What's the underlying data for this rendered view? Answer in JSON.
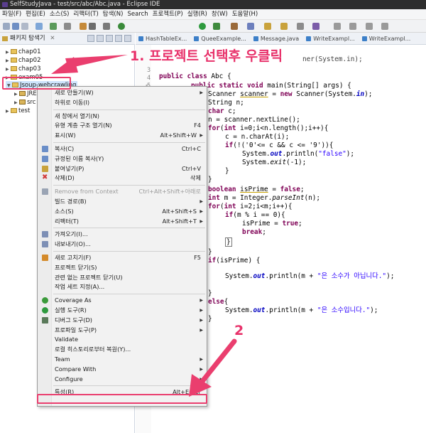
{
  "window": {
    "title": "SelfStudyJava - test/src/abc/Abc.java - Eclipse IDE"
  },
  "menubar": [
    "파일(F)",
    "편집(E)",
    "소스(S)",
    "리팩터(T)",
    "탐색(N)",
    "Search",
    "프로젝트(P)",
    "실행(R)",
    "창(W)",
    "도움말(H)"
  ],
  "explorer": {
    "title": "패키지 탐색기",
    "close": "✕",
    "items": [
      {
        "label": "chap01",
        "level": 0
      },
      {
        "label": "chap02",
        "level": 0
      },
      {
        "label": "chap03",
        "level": 0
      },
      {
        "label": "exam05",
        "level": 0
      },
      {
        "label": "Jsoup-webcrawling",
        "level": 0,
        "selected": true
      },
      {
        "label": "JRE",
        "level": 1
      },
      {
        "label": "src",
        "level": 1
      },
      {
        "label": "test",
        "level": 0
      }
    ]
  },
  "editor": {
    "tabs": [
      "HashTableEx...",
      "QueeExample...",
      "Message.java",
      "WriteExampl...",
      "WriteExampl..."
    ],
    "line_numbers": [
      "3",
      "4",
      "5",
      "5"
    ],
    "partial_line": "ner(System.in);"
  },
  "context_menu": {
    "items": [
      {
        "label": "새로 만들기(W)",
        "shortcut": "",
        "submenu": true
      },
      {
        "label": "하위로 이동(I)",
        "shortcut": ""
      },
      {
        "sep": true
      },
      {
        "label": "새 창에서 열기(N)",
        "shortcut": ""
      },
      {
        "label": "유형 계층 구조 열기(N)",
        "shortcut": "F4"
      },
      {
        "label": "표시(W)",
        "shortcut": "Alt+Shift+W",
        "submenu": true
      },
      {
        "sep": true
      },
      {
        "label": "복사(C)",
        "shortcut": "Ctrl+C",
        "icon": "copy-icon"
      },
      {
        "label": "규정된 이름 복사(Y)",
        "shortcut": "",
        "icon": "copy-icon"
      },
      {
        "label": "붙여넣기(P)",
        "shortcut": "Ctrl+V",
        "icon": "paste-icon"
      },
      {
        "label": "삭제(D)",
        "shortcut": "삭제",
        "icon": "delete-icon"
      },
      {
        "sep": true
      },
      {
        "label": "Remove from Context",
        "shortcut": "Ctrl+Alt+Shift+아래로",
        "dim": true,
        "icon": "remove-icon"
      },
      {
        "label": "빌드 경로(B)",
        "shortcut": "",
        "submenu": true
      },
      {
        "label": "소스(S)",
        "shortcut": "Alt+Shift+S",
        "submenu": true
      },
      {
        "label": "리팩터(T)",
        "shortcut": "Alt+Shift+T",
        "submenu": true
      },
      {
        "sep": true
      },
      {
        "label": "가져오기(I)...",
        "shortcut": "",
        "icon": "import-icon"
      },
      {
        "label": "내보내기(O)...",
        "shortcut": "",
        "icon": "export-icon"
      },
      {
        "sep": true
      },
      {
        "label": "새로 고치기(F)",
        "shortcut": "F5",
        "icon": "refresh-icon"
      },
      {
        "label": "프로젝트 닫기(S)",
        "shortcut": ""
      },
      {
        "label": "관련 없는 프로젝트 닫기(U)",
        "shortcut": ""
      },
      {
        "label": "작업 세트 지정(A)...",
        "shortcut": ""
      },
      {
        "sep": true
      },
      {
        "label": "Coverage As",
        "shortcut": "",
        "submenu": true,
        "icon": "coverage-icon"
      },
      {
        "label": "실행 도구(R)",
        "shortcut": "",
        "submenu": true,
        "icon": "run-icon"
      },
      {
        "label": "디버그 도구(D)",
        "shortcut": "",
        "submenu": true,
        "icon": "debug-icon"
      },
      {
        "label": "프로파일 도구(P)",
        "shortcut": "",
        "submenu": true
      },
      {
        "label": "Validate",
        "shortcut": ""
      },
      {
        "label": "로컬 히스토리로부터 복원(Y)...",
        "shortcut": ""
      },
      {
        "label": "Team",
        "shortcut": "",
        "submenu": true
      },
      {
        "label": "Compare With",
        "shortcut": "",
        "submenu": true
      },
      {
        "label": "Configure",
        "shortcut": "",
        "submenu": true
      },
      {
        "sep": true
      },
      {
        "label": "특성(R)",
        "shortcut": "Alt+Enter",
        "highlighted": true
      }
    ]
  },
  "annotations": {
    "step1": "1. 프로젝트 선택후 우클릭",
    "step2": "2"
  },
  "colors": {
    "annotation": "#ea3e6e",
    "keyword": "#7f0055",
    "string": "#2a00ff",
    "field": "#0000c0"
  }
}
